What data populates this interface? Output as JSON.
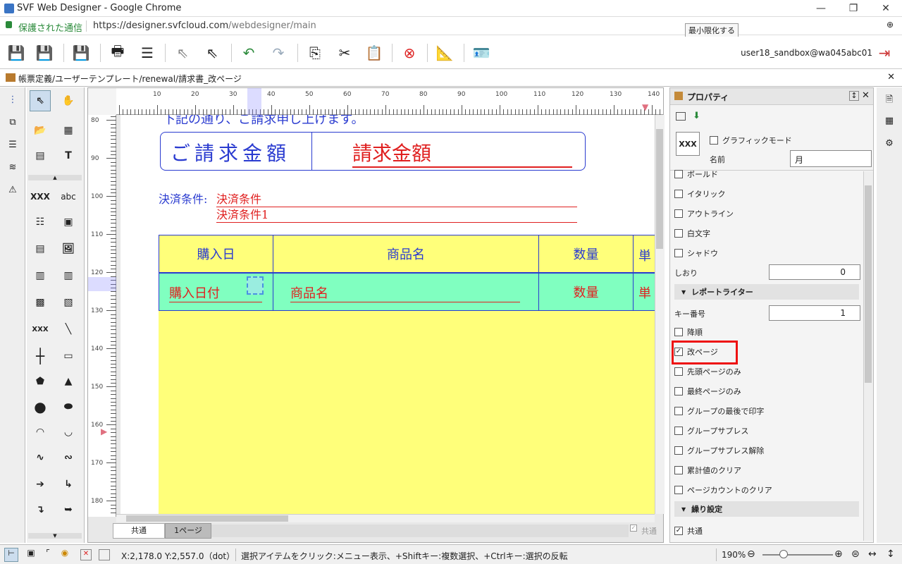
{
  "window": {
    "title": "SVF Web Designer - Google Chrome",
    "tooltip": "最小限化する"
  },
  "address": {
    "secure_label": "保護された通信",
    "url_host": "https://designer.svfcloud.com",
    "url_path": "/webdesigner/main"
  },
  "toolbar": {
    "user": "user18_sandbox@wa045abc01"
  },
  "document": {
    "path": "帳票定義/ユーザーテンプレート/renewal/請求書_改ページ"
  },
  "ruler": {
    "h_ticks": [
      "10",
      "20",
      "30",
      "40",
      "50",
      "60",
      "70",
      "80",
      "90",
      "100",
      "110",
      "120",
      "130",
      "140"
    ],
    "v_ticks": [
      "80",
      "90",
      "100",
      "110",
      "120",
      "130",
      "140",
      "150",
      "160",
      "170",
      "180"
    ]
  },
  "canvas": {
    "header_partial": "下記の通り、ご請求申し上げます。",
    "amount_label": "ご請求金額",
    "amount_field": "請求金額",
    "payment_label": "決済条件:",
    "payment_field1": "決済条件",
    "payment_field2": "決済条件1",
    "table_headers": [
      "購入日",
      "商品名",
      "数量",
      "単"
    ],
    "table_fields": [
      "購入日付",
      "商品名",
      "数量",
      "単"
    ]
  },
  "tabs": {
    "common": "共通",
    "page1": "1ページ",
    "common_check": "共通"
  },
  "panel": {
    "title": "プロパティ",
    "graphic_mode": "グラフィックモード",
    "name_label": "名前",
    "name_value": "月",
    "icon_label": "XXX",
    "rows_top": [
      "ボールド",
      "イタリック",
      "アウトライン",
      "白文字",
      "シャドウ"
    ],
    "bookmark_label": "しおり",
    "bookmark_value": "0",
    "section_writer": "レポートライター",
    "key_label": "キー番号",
    "key_value": "1",
    "rows_writer": [
      "降順",
      "改ページ",
      "先頭ページのみ",
      "最終ページのみ",
      "グループの最後で印字",
      "グループサプレス",
      "グループサプレス解除",
      "累計値のクリア",
      "ページカウントのクリア"
    ],
    "checked": [
      "改ページ",
      "共通"
    ],
    "highlight_color": "#ee1111",
    "section_repeat": "繰り設定",
    "common_label": "共通"
  },
  "tools": {
    "xxx": "XXX",
    "abc": "abc"
  },
  "status": {
    "coords": "X:2,178.0 Y:2,557.0（dot）",
    "hint": "選択アイテムをクリック:メニュー表示、+Shiftキー:複数選択、+Ctrlキー:選択の反転",
    "zoom": "190%"
  }
}
